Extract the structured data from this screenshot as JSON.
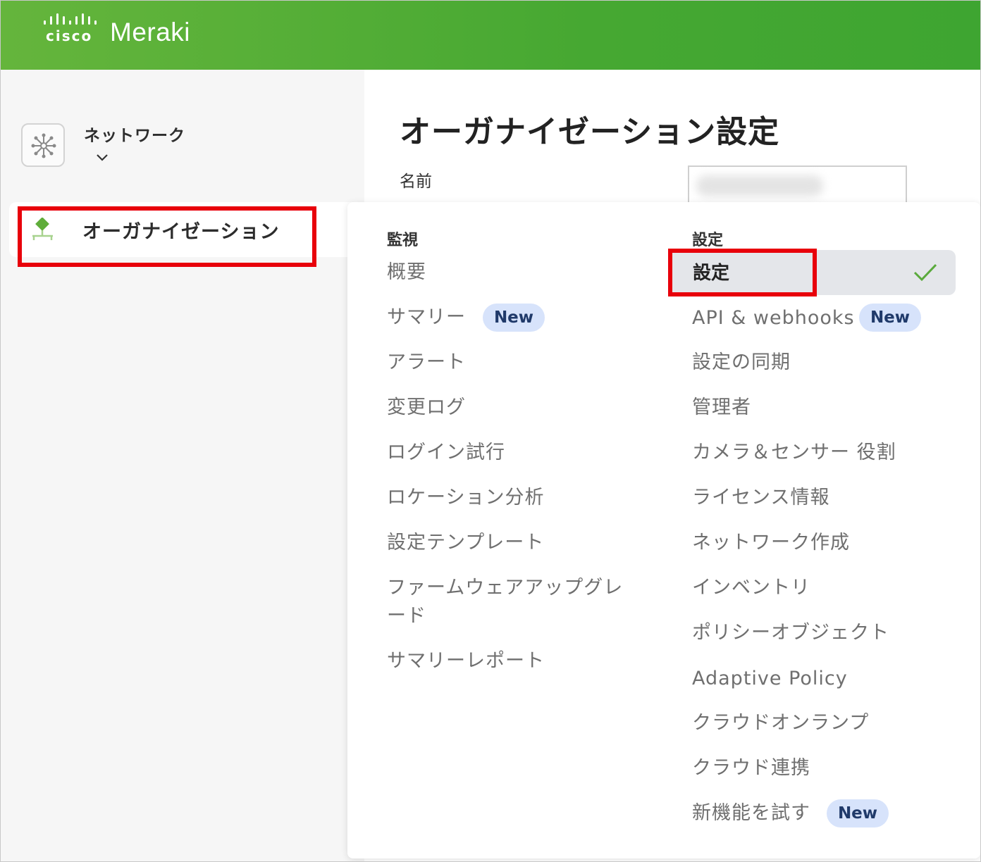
{
  "header": {
    "cisco_word": "cisco",
    "brand": "Meraki",
    "colors": {
      "green_start": "#65b53c",
      "green_end": "#3ea531"
    }
  },
  "sidebar": {
    "network": {
      "label": "ネットワーク",
      "icon": "network-hub-icon",
      "chevron": "chevron-down-icon"
    },
    "organization": {
      "label": "オーガナイゼーション",
      "icon": "organization-icon"
    }
  },
  "page": {
    "title": "オーガナイゼーション設定",
    "name_label": "名前"
  },
  "menu": {
    "monitor": {
      "heading": "監視",
      "items": [
        {
          "label": "概要"
        },
        {
          "label": "サマリー",
          "badge": "New"
        },
        {
          "label": "アラート"
        },
        {
          "label": "変更ログ"
        },
        {
          "label": "ログイン試行"
        },
        {
          "label": "ロケーション分析"
        },
        {
          "label": "設定テンプレート"
        },
        {
          "label": "ファームウェアアップグレード"
        },
        {
          "label": "サマリーレポート"
        }
      ]
    },
    "settings": {
      "heading": "設定",
      "active": "設定",
      "items": [
        {
          "label": "API & webhooks",
          "badge": "New"
        },
        {
          "label": "設定の同期"
        },
        {
          "label": "管理者"
        },
        {
          "label": "カメラ＆センサー 役割"
        },
        {
          "label": "ライセンス情報"
        },
        {
          "label": "ネットワーク作成"
        },
        {
          "label": "インベントリ"
        },
        {
          "label": "ポリシーオブジェクト"
        },
        {
          "label": "Adaptive Policy"
        },
        {
          "label": "クラウドオンランプ"
        },
        {
          "label": "クラウド連携"
        },
        {
          "label": "新機能を試す",
          "badge": "New"
        }
      ]
    }
  },
  "highlight_color": "#e8000b",
  "check_color": "#5aaa3c"
}
